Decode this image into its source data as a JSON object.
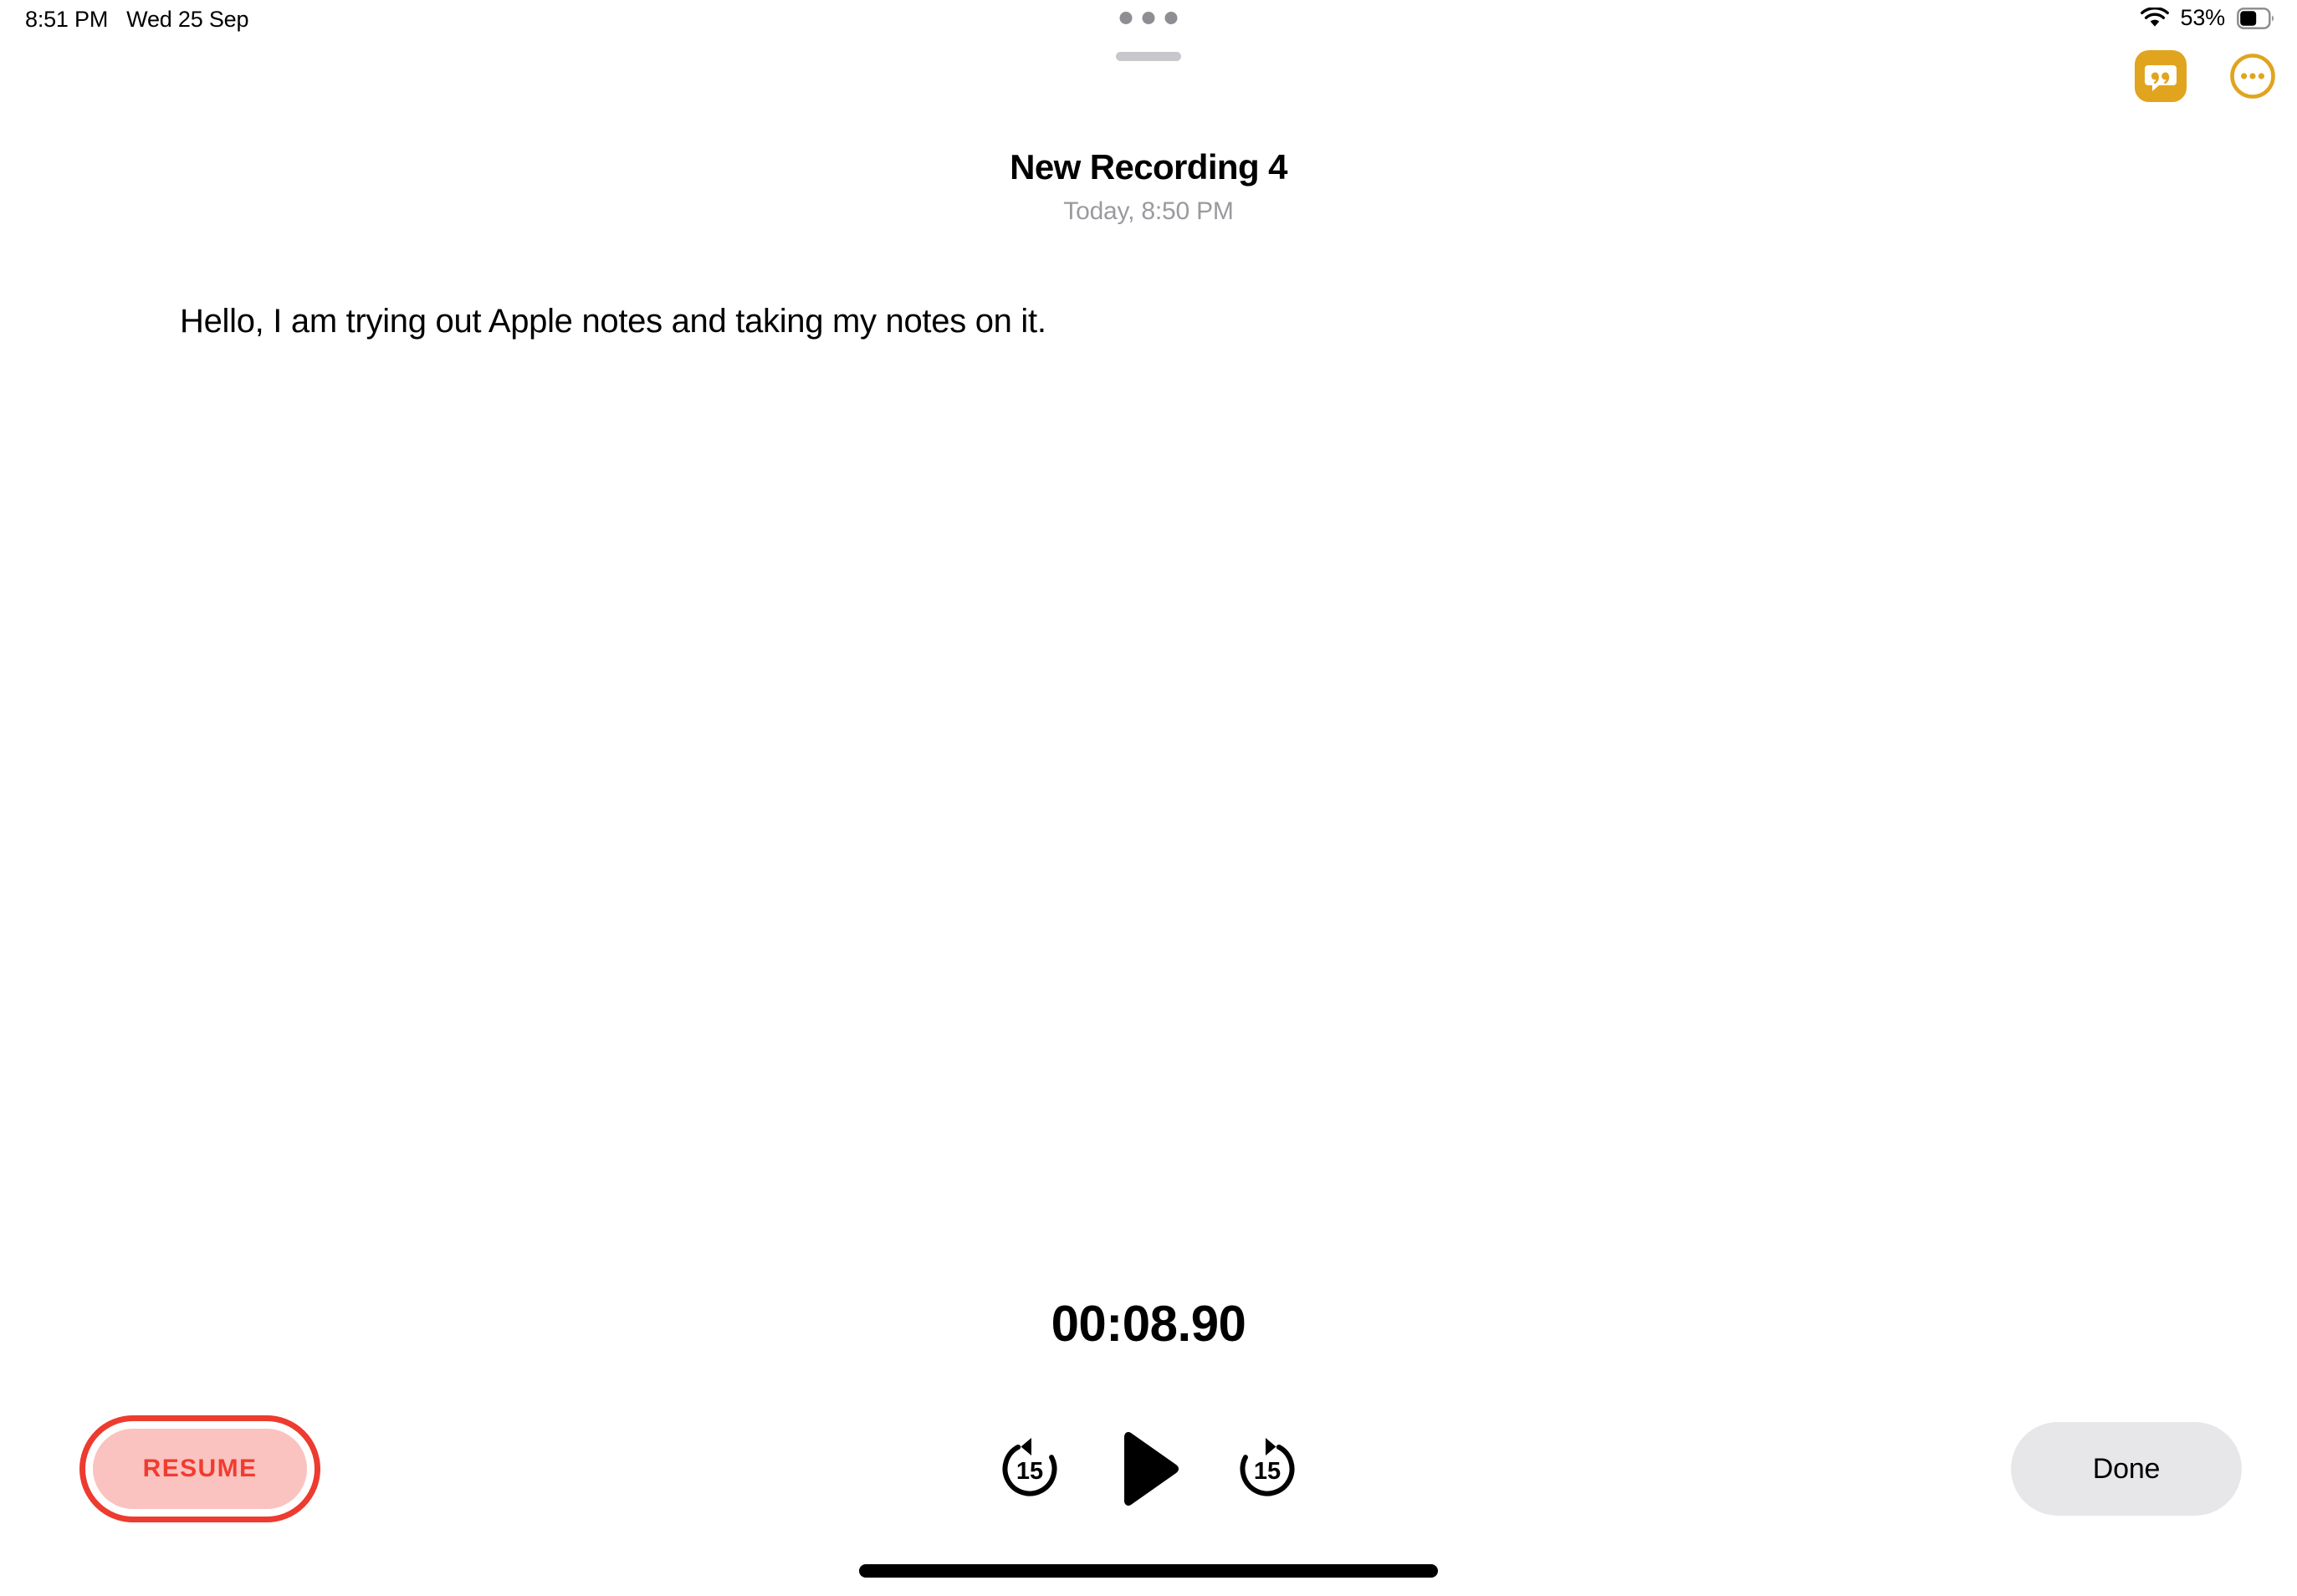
{
  "status_bar": {
    "time": "8:51 PM",
    "date": "Wed 25 Sep",
    "battery_percent": "53%",
    "wifi_icon": "wifi-icon",
    "battery_icon": "battery-icon",
    "battery_level": 53
  },
  "window_chrome": {
    "multitask_dots_icon": "multitask-dots-icon",
    "drag_handle_icon": "drag-handle-icon"
  },
  "top_actions": {
    "transcript_icon": "transcript-quote-icon",
    "more_icon": "more-circle-icon",
    "accent_color": "#E0A41E"
  },
  "recording": {
    "title": "New Recording 4",
    "subtitle": "Today, 8:50 PM"
  },
  "note": {
    "text": "Hello, I am trying out Apple notes and taking my notes on it."
  },
  "player": {
    "elapsed": "00:08.90",
    "skip_back_label": "15",
    "skip_forward_label": "15",
    "skip_back_icon": "skip-back-15-icon",
    "play_icon": "play-icon",
    "skip_forward_icon": "skip-forward-15-icon"
  },
  "controls": {
    "resume_label": "RESUME",
    "resume_text_color": "#F23B30",
    "resume_fill_color": "#FAC3C0",
    "resume_ring_color": "#ED3B30",
    "done_label": "Done",
    "done_fill_color": "#E7E7EA"
  },
  "home_indicator": {
    "icon": "home-indicator"
  }
}
